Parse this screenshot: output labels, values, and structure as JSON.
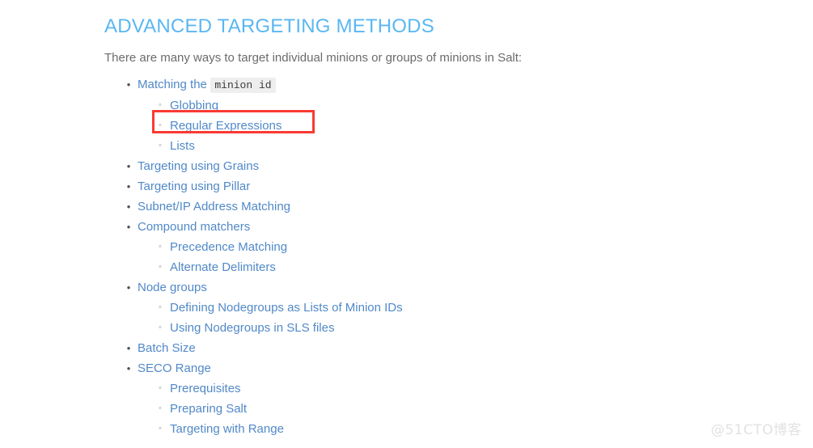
{
  "page": {
    "title": "ADVANCED TARGETING METHODS",
    "intro": "There are many ways to target individual minions or groups of minions in Salt:",
    "title_color": "#5ab7f2",
    "link_color": "#5189c8",
    "text_color": "#6b6b6b"
  },
  "annotation": {
    "type": "red-rectangle-highlight",
    "target_label": "Regular Expressions",
    "color": "#f93a33",
    "border_width_px": 3
  },
  "watermark": {
    "text": "@51CTO博客",
    "color": "#e2e2e2"
  },
  "bullets": {
    "level1": "•",
    "level2": "◦"
  },
  "toc": [
    {
      "label_prefix": "Matching the ",
      "label_code": "minion id",
      "label": "Matching the",
      "children": [
        {
          "label": "Globbing"
        },
        {
          "label": "Regular Expressions",
          "highlighted": true
        },
        {
          "label": "Lists"
        }
      ]
    },
    {
      "label": "Targeting using Grains",
      "children": []
    },
    {
      "label": "Targeting using Pillar",
      "children": []
    },
    {
      "label": "Subnet/IP Address Matching",
      "children": []
    },
    {
      "label": "Compound matchers",
      "children": [
        {
          "label": "Precedence Matching"
        },
        {
          "label": "Alternate Delimiters"
        }
      ]
    },
    {
      "label": "Node groups",
      "children": [
        {
          "label": "Defining Nodegroups as Lists of Minion IDs"
        },
        {
          "label": "Using Nodegroups in SLS files"
        }
      ]
    },
    {
      "label": "Batch Size",
      "children": []
    },
    {
      "label": "SECO Range",
      "children": [
        {
          "label": "Prerequisites"
        },
        {
          "label": "Preparing Salt"
        },
        {
          "label": "Targeting with Range"
        }
      ]
    }
  ]
}
